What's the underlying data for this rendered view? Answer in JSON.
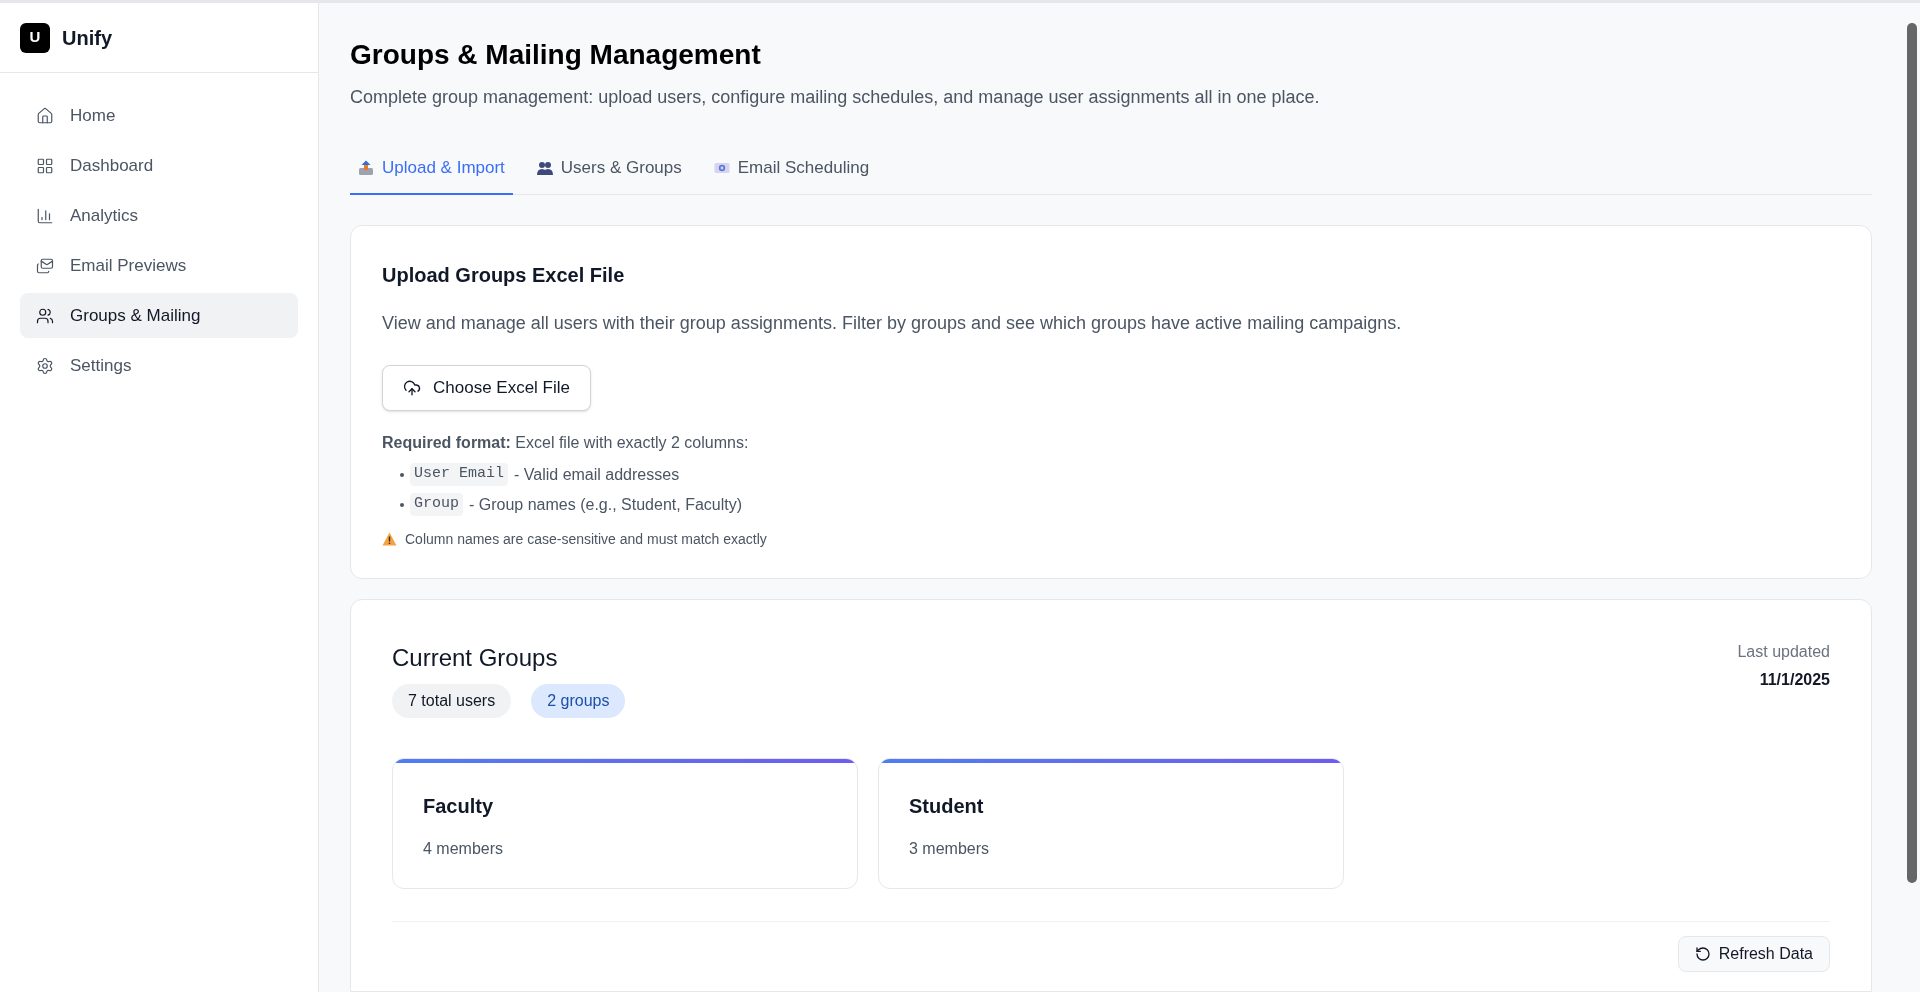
{
  "app": {
    "logo_letter": "U",
    "name": "Unify"
  },
  "sidebar": {
    "items": [
      {
        "label": "Home",
        "selected": false
      },
      {
        "label": "Dashboard",
        "selected": false
      },
      {
        "label": "Analytics",
        "selected": false
      },
      {
        "label": "Email Previews",
        "selected": false
      },
      {
        "label": "Groups & Mailing",
        "selected": true
      },
      {
        "label": "Settings",
        "selected": false
      }
    ]
  },
  "page": {
    "title": "Groups & Mailing Management",
    "subtitle": "Complete group management: upload users, configure mailing schedules, and manage user assignments all in one place."
  },
  "tabs": [
    {
      "label": "Upload & Import",
      "selected": true
    },
    {
      "label": "Users & Groups",
      "selected": false
    },
    {
      "label": "Email Scheduling",
      "selected": false
    }
  ],
  "upload_card": {
    "title": "Upload Groups Excel File",
    "description": "View and manage all users with their group assignments. Filter by groups and see which groups have active mailing campaigns.",
    "button": "Choose Excel File",
    "format_note": "**Required format:** Excel file with exactly 2 columns:",
    "columns": [
      {
        "code": "User Email",
        "text": "- Valid email addresses"
      },
      {
        "code": "Group",
        "text": "- Group names (e.g., Student, Faculty)"
      }
    ],
    "warning": "Column names are case-sensitive and must match exactly"
  },
  "groups_card": {
    "title": "Current Groups",
    "badges": [
      {
        "label": "7 total users",
        "kind": "neutral"
      },
      {
        "label": "2 groups",
        "kind": "info"
      }
    ],
    "last_updated_label": "Last updated",
    "last_updated": "11/1/2025",
    "groups": [
      {
        "name": "Faculty",
        "members": "4 members"
      },
      {
        "name": "Student",
        "members": "3 members"
      }
    ],
    "refresh_button": "Refresh Data"
  }
}
